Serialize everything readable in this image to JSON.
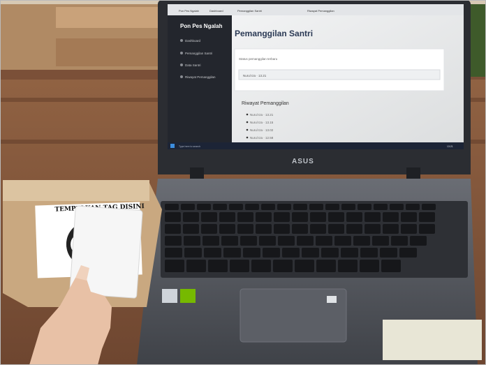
{
  "screen": {
    "browser_tabs": [
      "Pon Pes Ngalah",
      "Dashboard",
      "Pemanggilan Santri",
      "Riwayat Pemanggilan"
    ],
    "sidebar": {
      "brand": "Pon Pes Ngalah",
      "items": [
        {
          "label": "Dashboard"
        },
        {
          "label": "Pemanggilan Santri"
        },
        {
          "label": "Data Santri"
        },
        {
          "label": "Riwayat Pemanggilan"
        }
      ]
    },
    "main": {
      "title": "Pemanggilan Santri",
      "card_label": "Status pemanggilan terbaru",
      "current_value": "Nurul Iza · 13.21",
      "history_title": "Riwayat Pemanggilan",
      "history": [
        "Nurul Iza · 13.21",
        "Nurul Iza · 13.15",
        "Nurul Iza · 13.02",
        "Nurul Iza · 12.58"
      ]
    },
    "taskbar": {
      "search": "Type here to search",
      "clock": "13:21"
    }
  },
  "laptop_brand": "ASUS",
  "box_sign": "TEMPELKAN TAG DISINI",
  "colors": {
    "table_wood": "#8a5a3c",
    "laptop_body": "#4e5158",
    "screen_sidebar": "#23262d",
    "accent": "#2b6cb0"
  }
}
